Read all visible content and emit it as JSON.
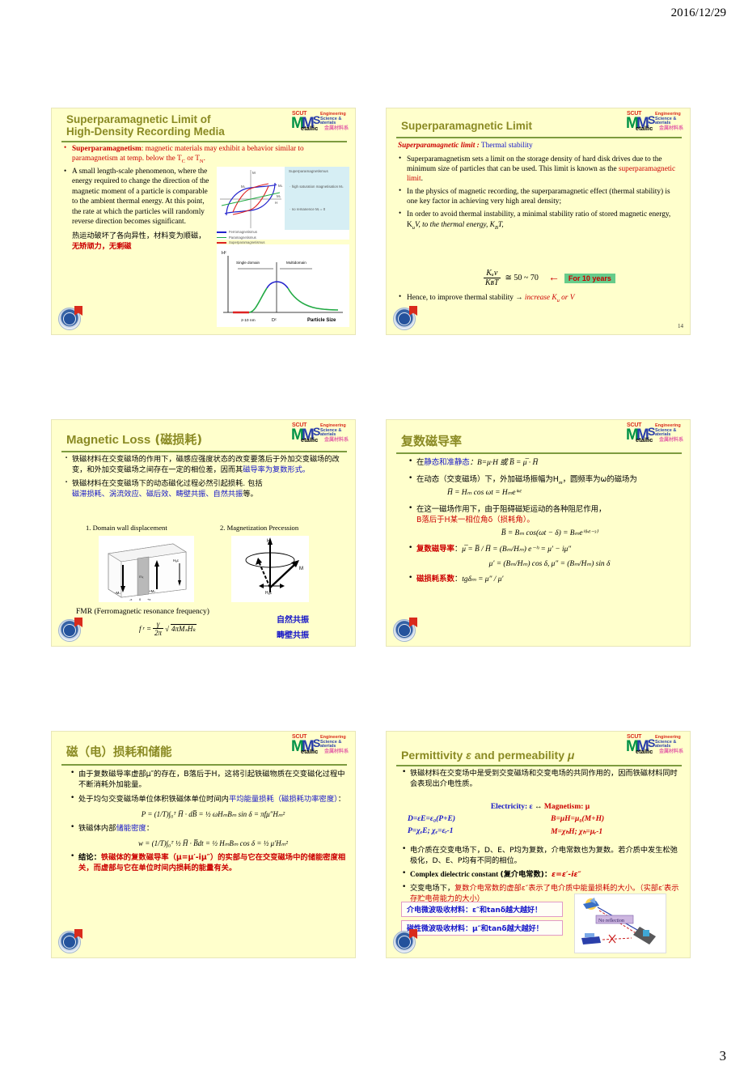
{
  "header": {
    "date": "2016/12/29"
  },
  "footer": {
    "page_number": "3"
  },
  "logo": {
    "scut": "SCUT",
    "m1": "M",
    "m2": "M",
    "s": "S",
    "line1": "Engineering",
    "line2": "Science &",
    "line3": "aterials",
    "metallic": "etallic",
    "cn": "金属材料系",
    "colors": {
      "red": "#d92b1c",
      "green": "#009246",
      "blue": "#2a3faa",
      "pink": "#e566a8"
    }
  },
  "colors": {
    "slide_bg": "#ffffcc",
    "title": "#8a8a23",
    "rule": "#7d9b3f",
    "red": "#cc0000",
    "blue": "#1414c8",
    "green_tag_bg": "#66cc8a",
    "pink_border": "#e29ac6"
  },
  "slides": [
    {
      "id": "slide-superparamagnetic-limit-of-high-density-recording-media",
      "title_line1": "Superparamagnetic Limit of",
      "title_line2": "High-Density Recording Media",
      "bullets": [
        {
          "lead": "Superparamagnetism",
          "text": ": magnetic materials may exhibit a behavior similar to paramagnetism at temp. below the T",
          "sub1": "C",
          "mid": " or T",
          "sub2": "N",
          "tail": "."
        },
        {
          "text": "A small length-scale phenomenon, where the energy required to change the direction of the magnetic moment of a particle is comparable to the ambient thermal energy. At this point, the rate at which the particles will randomly reverse direction becomes significant."
        }
      ],
      "cn_note_black": "热运动破坏了各向异性，材料变为顺磁，",
      "cn_note_red": "无矫顽力，无剩磁",
      "figure_hysteresis": {
        "panel_heading": "Superparamagnetismus",
        "panel_bullets": [
          "high saturation magnetisation Mₛ",
          "no remanence Mᵣ = 0"
        ],
        "axis_labels": [
          "M",
          "Mₛ",
          "Mₛ",
          "Mᵣ",
          "H"
        ],
        "legend": [
          {
            "label": "Ferromagnetismus",
            "color": "#2222cc"
          },
          {
            "label": "Paramagnetismus",
            "color": "#22aa44"
          },
          {
            "label": "Superparamagnetismus",
            "color": "#dd2222"
          }
        ]
      },
      "figure_particle_size": {
        "yaxis": "Hᴄ",
        "xaxis": "Particle Size",
        "region_left": "Single domain",
        "region_right": "Multidomain",
        "tick_left": "2-10 nm",
        "tick_dc": "Dᴄ"
      }
    },
    {
      "id": "slide-superparamagnetic-limit",
      "title_line1": "Superparamagnetic Limit",
      "subhead_red": "Superparamagnetic limit :",
      "subhead_blue": " Thermal stability",
      "bullets": [
        {
          "pre": "Superparamagnetism sets a limit on the storage density of hard disk drives due to the minimum size of particles that can be used. This limit is known as the ",
          "red": "superparamagnetic limit",
          "post": "."
        },
        {
          "pre": "In the physics of magnetic recording, the superparamagnetic effect (thermal stability) is one key factor in achieving very high areal density;"
        },
        {
          "pre": "In order to avoid thermal instability, a minimal stability ratio of stored magnetic energy, K",
          "sub_a": "u",
          "mid": "V, to the thermal energy, K",
          "sub_b": "B",
          "post": "T,"
        }
      ],
      "formula": {
        "num": "Kᵤv",
        "den": "KʙT",
        "rhs": "≅ 50 ~ 70",
        "tag": "For 10 years",
        "arrow": "←"
      },
      "last_bullet": {
        "black": "Hence, to improve thermal stability → ",
        "red": "increase K",
        "red_sub": "u",
        "red_tail": " or V"
      },
      "slide_number": "14"
    },
    {
      "id": "slide-magnetic-loss",
      "title_en": "Magnetic Loss",
      "title_cn": " (磁损耗)",
      "bullets": [
        {
          "black1": "铁磁材料在交变磁场的作用下，磁感应强度状态的改变要落后于外加交变磁场的改变，和外加交变磁场之间存在一定的相位差，因而其",
          "blue1": "磁导率为复数形式。"
        },
        {
          "black1": "铁磁材料在交变磁场下的动态磁化过程必然引起损耗. 包括",
          "blue1": "磁滞损耗、涡流效应、磁后效、畴壁共振、自然共振",
          "black2": "等。"
        }
      ],
      "fig_caption_1": "1. Domain wall displacement",
      "fig_caption_2": "2. Magnetization Precession",
      "fig1_labels": [
        "-Mₛ",
        "+Mₛ",
        "mₓ",
        "Hₐc",
        "-x",
        "0",
        "+x"
      ],
      "fig2_labels": [
        "H",
        "M",
        "Hₐc"
      ],
      "fmr_caption": "FMR (Ferromagnetic resonance frequency)",
      "fmr_formula": {
        "lhs": "f",
        "lhs_sub": "r",
        "eq": "=",
        "frac_num": "γ",
        "frac_den": "2π",
        "sqrt": "4πMₛHₖ"
      },
      "right_notes": [
        "自然共振",
        "畴壁共振"
      ]
    },
    {
      "id": "slide-complex-permeability",
      "title_cn": "复数磁导率",
      "bullets": [
        {
          "black1": "在",
          "blue1": "静态和准静态",
          "black2": "：B=μ·H 或 ",
          "formula": "B̅ = μ̅ · H̅"
        },
        {
          "black1": "在动态（交变磁场）下，外加磁场振幅为H",
          "sub1": "m",
          "black2": "，圆频率为ω的磁场为 ",
          "formula": "H̅ = Hₘ cos ωt = Hₘeⁱʷᵗ"
        },
        {
          "black1": "在这一磁场作用下，由于阻碍磁矩运动的各种阻尼作用，",
          "red1": "B落后于H某一相位角δ（损耗角）。",
          "formula": "B̅ = Bₘ cos(ωt − δ) = Bₘeⁱ⁽ʷᵗ⁻ᶟ⁾"
        },
        {
          "red1": "复数磁导率",
          "black1": "：",
          "formula": "μ̅ = B̅ / H̅ = (Bₘ/Hₘ) e⁻ⁱᶟ = μ′ − iμ″",
          "formula2": "μ′ = (Bₘ/Hₘ) cos δ, μ″ = (Bₘ/Hₘ) sin δ"
        },
        {
          "red1": "磁损耗系数",
          "black1": "：",
          "formula": "tgδₘ = μ″ / μ′"
        }
      ]
    },
    {
      "id": "slide-loss-and-storage",
      "title_cn": "磁（电）损耗和储能",
      "bullets": [
        {
          "black1": "由于复数磁导率虚部μ″的存在，B落后于H，这将引起铁磁物质在交变磁化过程中不断消耗外加能量。"
        },
        {
          "black1": "处于均匀交变磁场单位体积铁磁体单位时间内",
          "blue1": "平均能量损耗（磁损耗功率密度）",
          "black2": "：",
          "formula": "P = (1/T)∫₀ᵀ H̅ · dB̅ = ½ ωHₘBₘ sin δ = πfμ″Hₘ²"
        },
        {
          "black1": "铁磁体内部",
          "blue1": "储能密度",
          "black2": "：",
          "formula": "w = (1/T)∫₀ᵀ ½ H̅ · B̅dt = ½ HₘBₘ cos δ = ½ μ′Hₘ²"
        },
        {
          "black1": "结论：",
          "red1": "铁磁体的复数磁导率（μ=μ′-iμ″）的实部与它在交变磁场中的储能密度相关，而虚部与它在单位时间内损耗的能量有关。"
        }
      ]
    },
    {
      "id": "slide-permittivity-and-permeability",
      "title_a": "Permittivity ",
      "title_eps": "ε",
      "title_b": " and permeability ",
      "title_mu": "μ",
      "bullets": [
        {
          "black1": "铁磁材料在交变场中是受到交变磁场和交变电场的共同作用的，因而铁磁材料同时会表现出介电性质。"
        }
      ],
      "eq_head_blue": "Electricity: ε",
      "eq_head_arrow": " ↔ ",
      "eq_head_red": "Magnetism: μ",
      "eq_rows": [
        {
          "left": "D=εE=ε₀(P+E)",
          "right": "B=μH=μ₀(M+H)"
        },
        {
          "left": "P=χₑE; χₑ=εᵣ-1",
          "right": "M=χₕH; χₕ=μᵣ-1"
        }
      ],
      "bullets2": [
        {
          "black1": "电介质在交变电场下，D、E、P均为复数，介电常数也为复数。若介质中发生松弛极化，D、E、P均有不同的相位。"
        },
        {
          "bold_en": "Complex dielectric constant ",
          "cn": "(复介电常数)：",
          "red": "ε=ε′-iε″"
        },
        {
          "black1": "交变电场下，",
          "red1": "复数介电常数的虚部ε″表示了电介质中能量损耗的大小。（实部ε′表示存贮电荷能力的大小）"
        }
      ],
      "boxes": [
        "介电微波吸收材料：ε″和tanδ越大越好！",
        "磁性微波吸收材料：μ″和tanδ越大越好！"
      ],
      "figure_label": "No reflection"
    }
  ]
}
